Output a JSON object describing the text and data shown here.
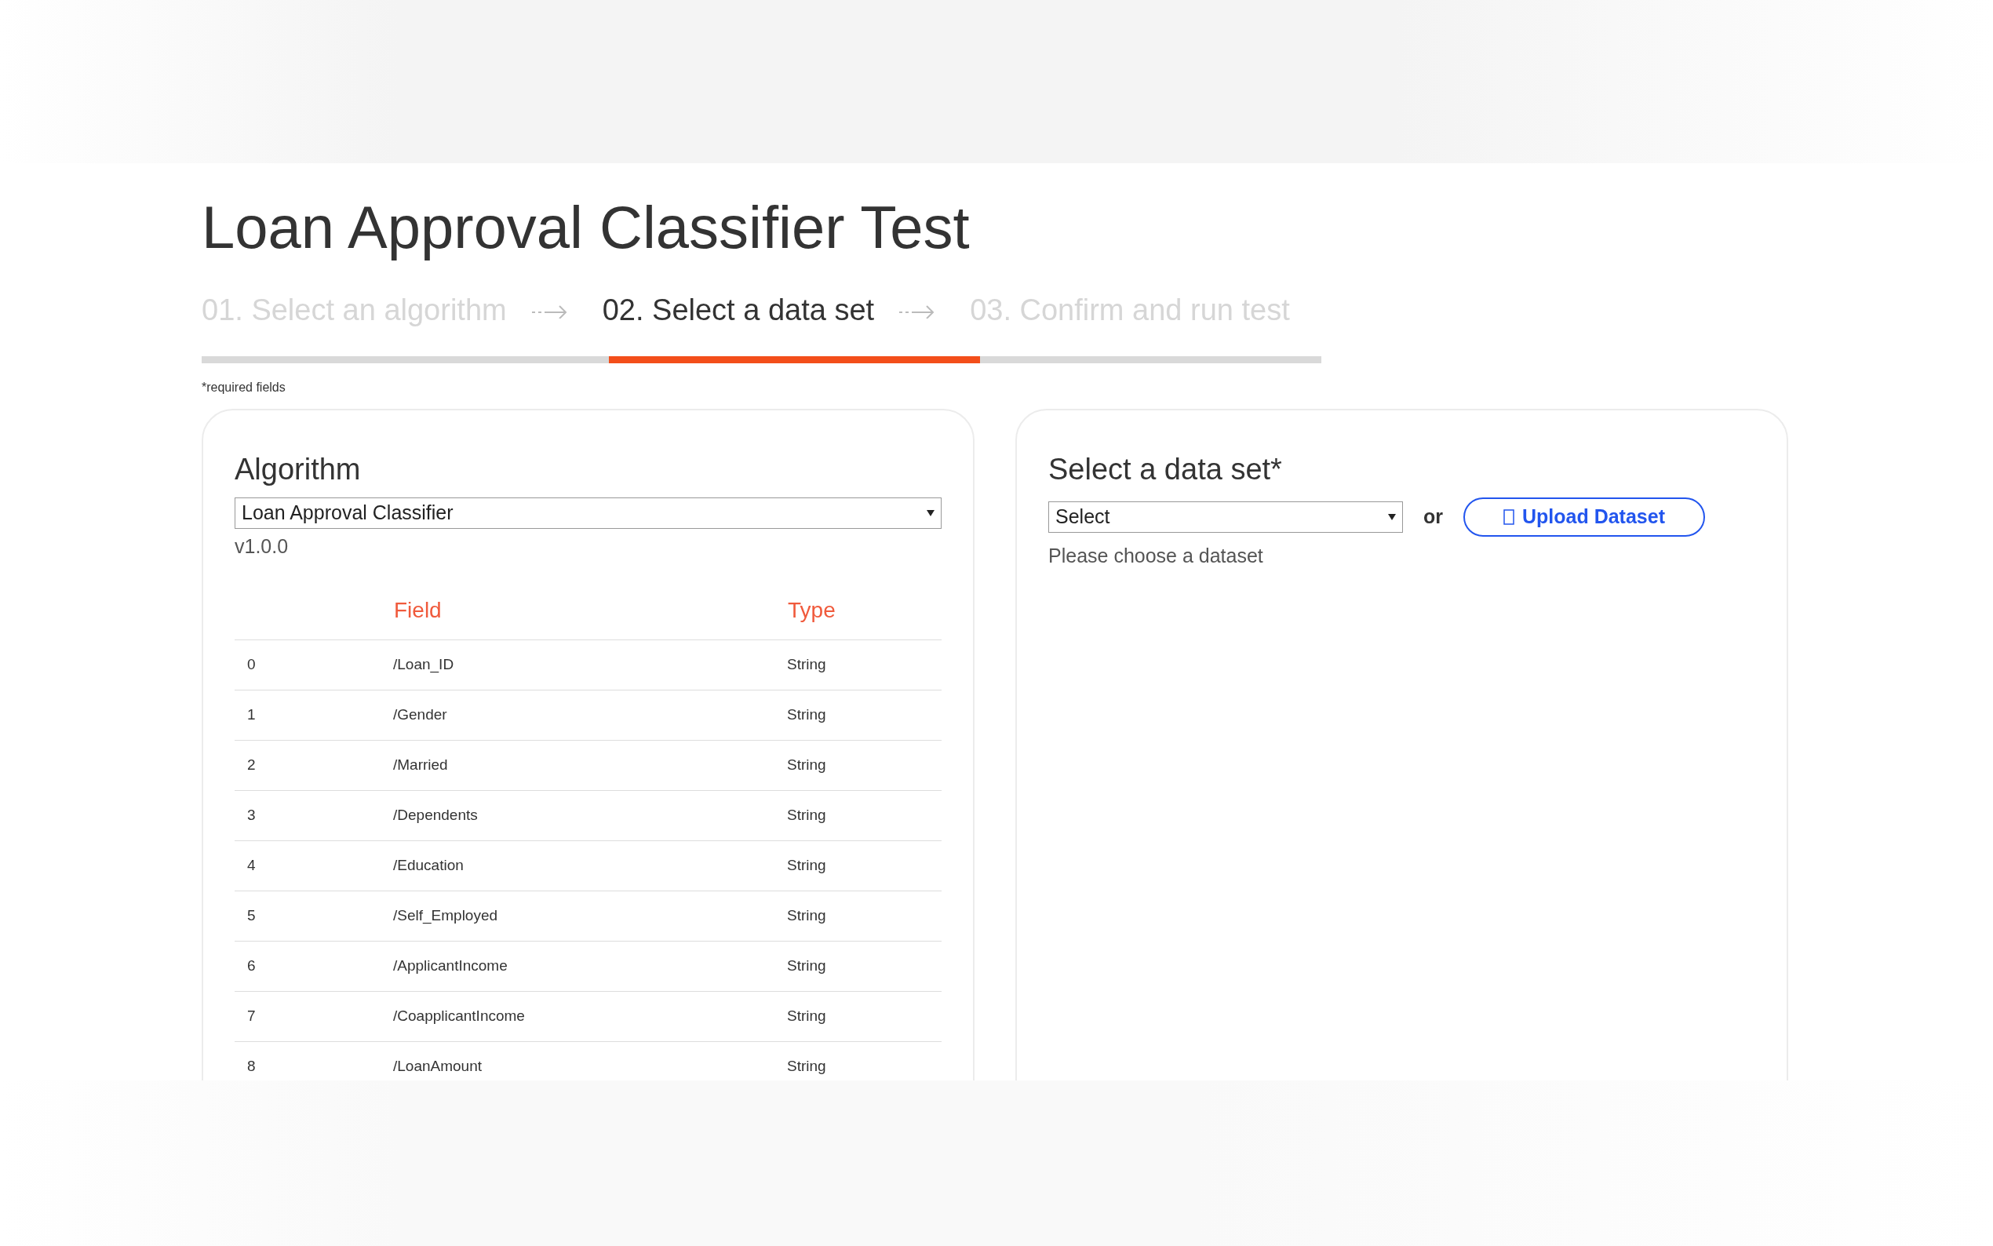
{
  "page": {
    "title": "Loan Approval Classifier Test"
  },
  "steps": [
    {
      "label": "01. Select an algorithm",
      "selected": false
    },
    {
      "label": "02. Select a data set",
      "selected": true
    },
    {
      "label": "03. Confirm and run test",
      "selected": false
    }
  ],
  "required_note": "*required fields",
  "algorithm_card": {
    "heading": "Algorithm",
    "select_value": "Loan Approval Classifier",
    "version": "v1.0.0",
    "table": {
      "columns": [
        "Field",
        "Type"
      ],
      "rows": [
        {
          "index": "0",
          "field": "/Loan_ID",
          "type": "String"
        },
        {
          "index": "1",
          "field": "/Gender",
          "type": "String"
        },
        {
          "index": "2",
          "field": "/Married",
          "type": "String"
        },
        {
          "index": "3",
          "field": "/Dependents",
          "type": "String"
        },
        {
          "index": "4",
          "field": "/Education",
          "type": "String"
        },
        {
          "index": "5",
          "field": "/Self_Employed",
          "type": "String"
        },
        {
          "index": "6",
          "field": "/ApplicantIncome",
          "type": "String"
        },
        {
          "index": "7",
          "field": "/CoapplicantIncome",
          "type": "String"
        },
        {
          "index": "8",
          "field": "/LoanAmount",
          "type": "String"
        }
      ]
    }
  },
  "dataset_card": {
    "heading": "Select a data set*",
    "select_value": "Select",
    "or_text": "or",
    "upload_button": "Upload Dataset",
    "hint": "Please choose a dataset"
  }
}
